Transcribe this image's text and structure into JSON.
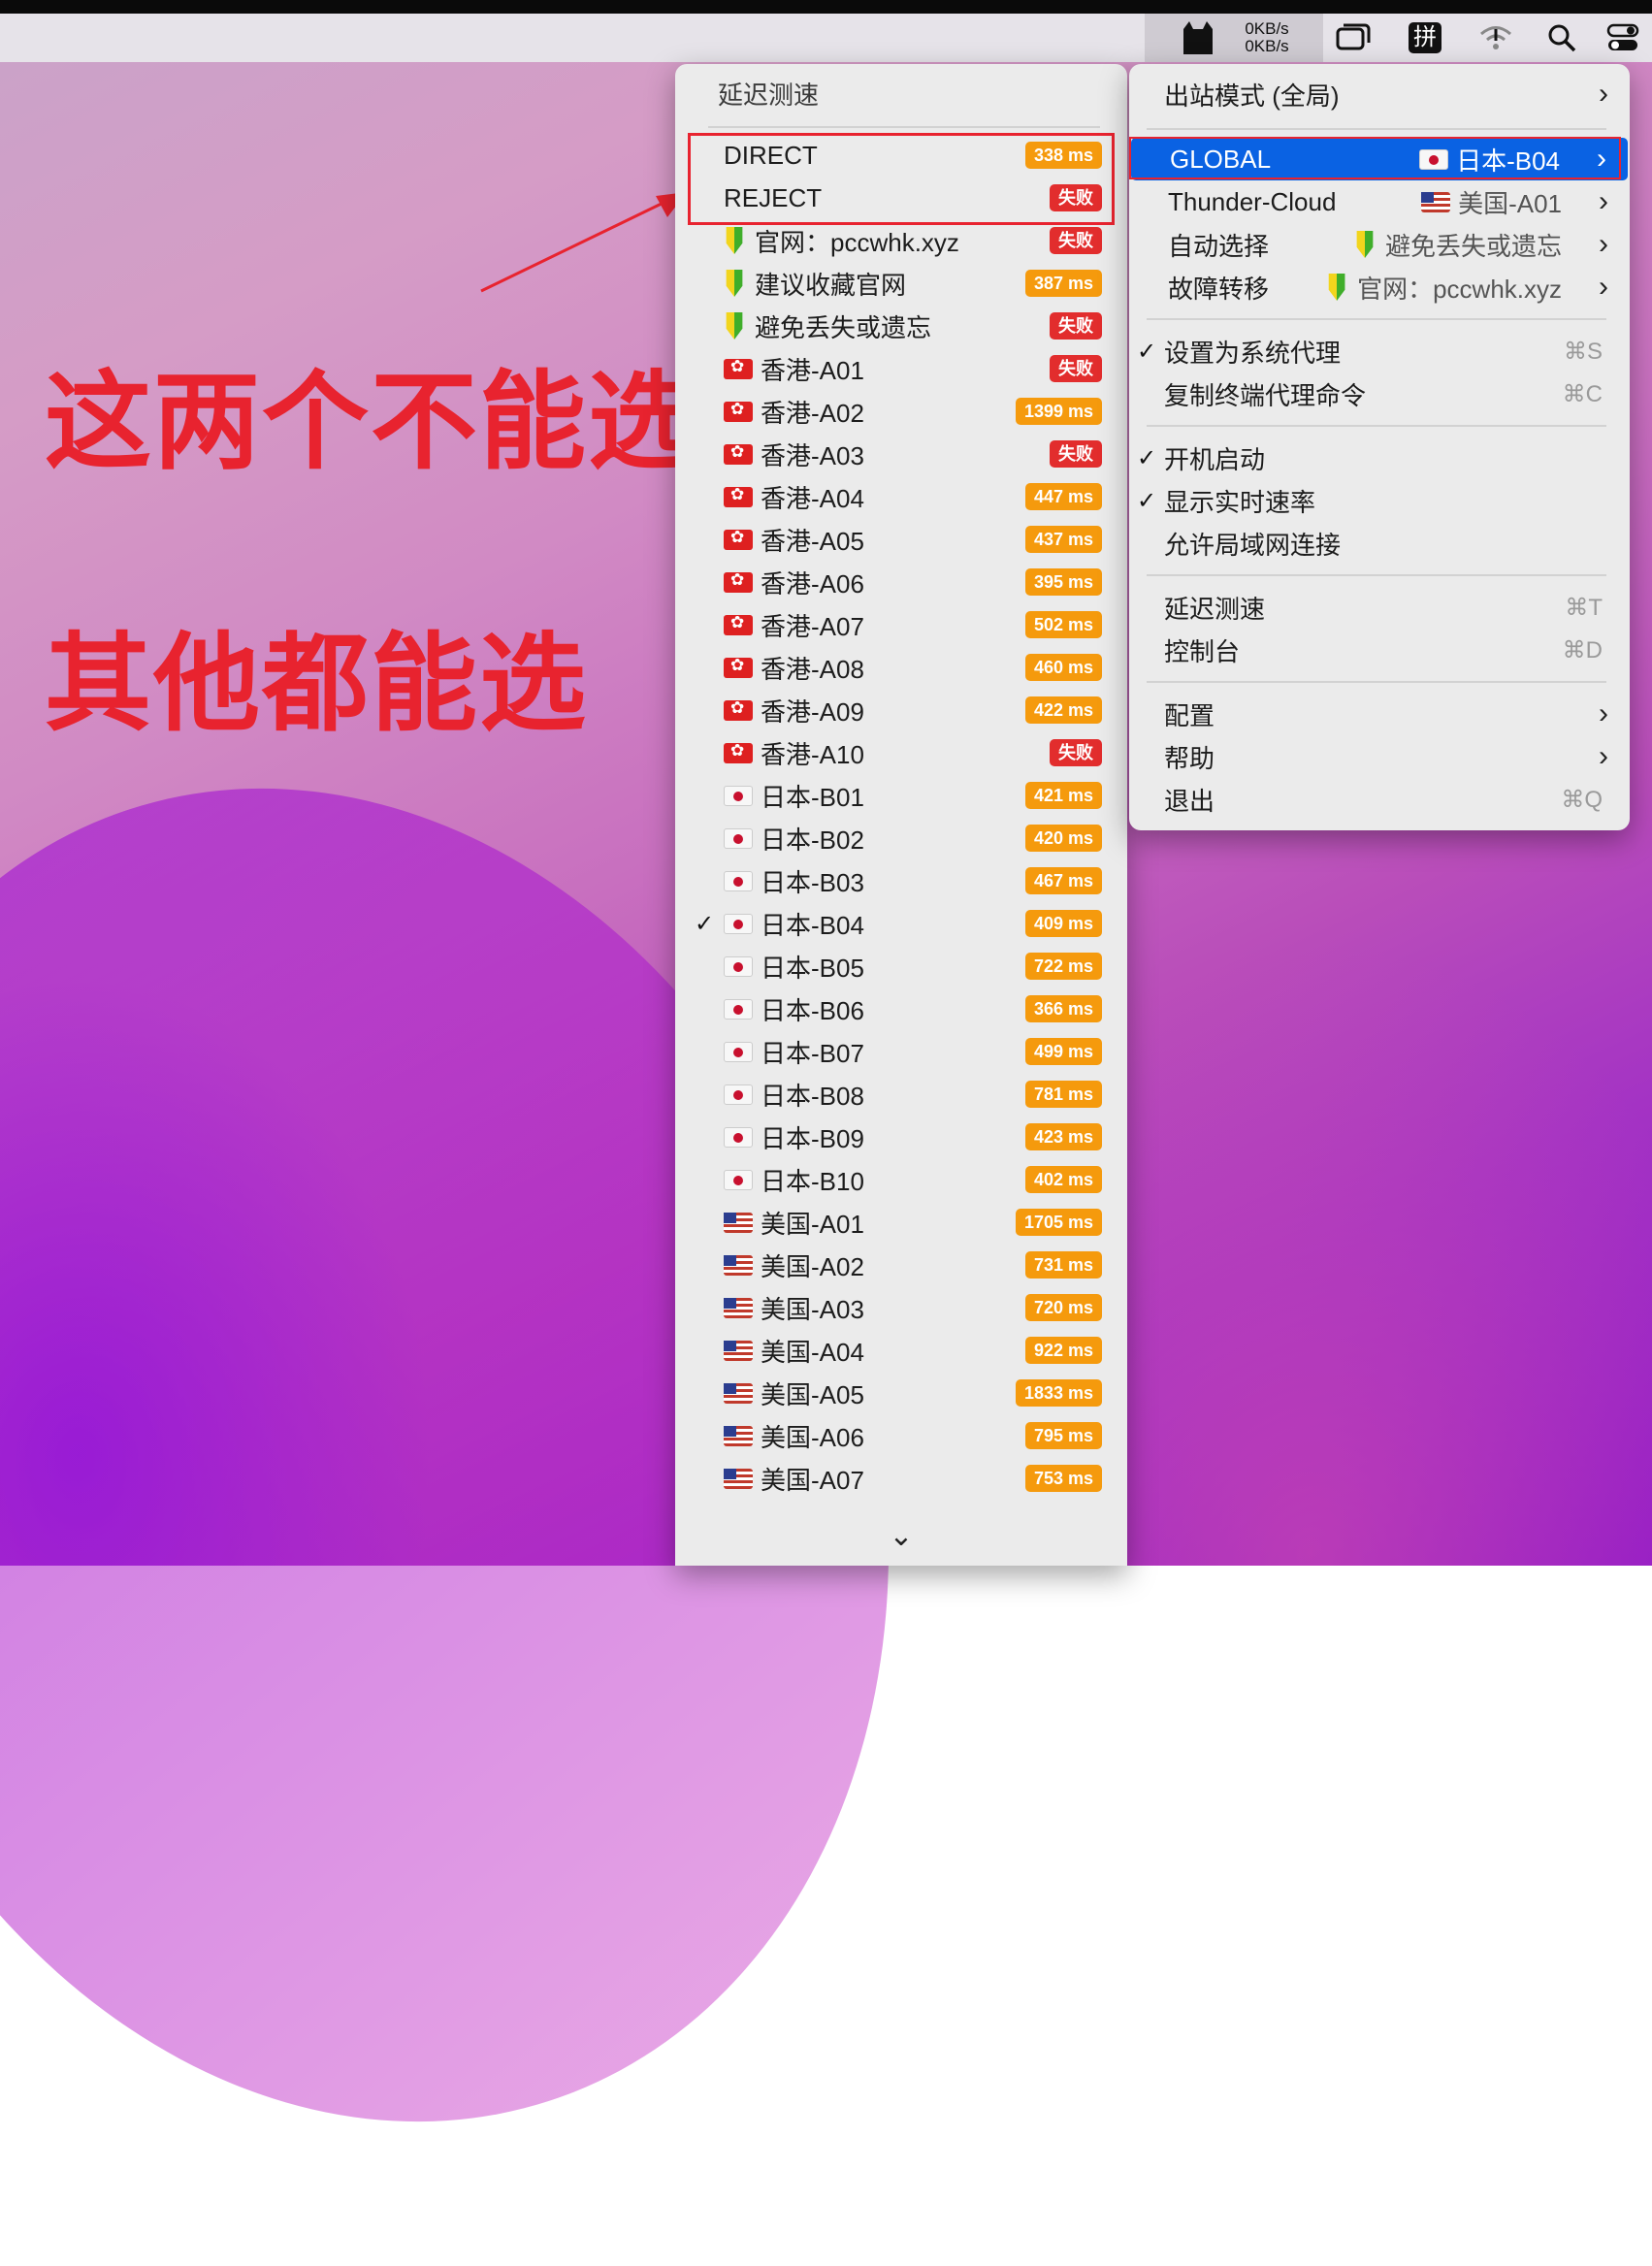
{
  "menubar": {
    "speed_up": "0KB/s",
    "speed_down": "0KB/s",
    "icons": [
      "cat-icon",
      "window-icon",
      "pinyin-icon",
      "wifi-icon",
      "search-icon",
      "control-center-icon"
    ],
    "pinyin_label": "拼"
  },
  "annotation": {
    "line1": "这两个不能选",
    "line2": "其他都能选",
    "color": "#e8232f"
  },
  "proxy_menu": {
    "header": "延迟测速",
    "items": [
      {
        "name": "DIRECT",
        "flag": "",
        "latency": "338 ms",
        "status": "ok"
      },
      {
        "name": "REJECT",
        "flag": "",
        "latency": "失败",
        "status": "fail"
      },
      {
        "name": "官网：pccwhk.xyz",
        "flag": "shield",
        "latency": "失败",
        "status": "fail"
      },
      {
        "name": "建议收藏官网",
        "flag": "shield",
        "latency": "387 ms",
        "status": "ok"
      },
      {
        "name": "避免丢失或遗忘",
        "flag": "shield",
        "latency": "失败",
        "status": "fail"
      },
      {
        "name": "香港-A01",
        "flag": "hk",
        "latency": "失败",
        "status": "fail"
      },
      {
        "name": "香港-A02",
        "flag": "hk",
        "latency": "1399 ms",
        "status": "ok"
      },
      {
        "name": "香港-A03",
        "flag": "hk",
        "latency": "失败",
        "status": "fail"
      },
      {
        "name": "香港-A04",
        "flag": "hk",
        "latency": "447 ms",
        "status": "ok"
      },
      {
        "name": "香港-A05",
        "flag": "hk",
        "latency": "437 ms",
        "status": "ok"
      },
      {
        "name": "香港-A06",
        "flag": "hk",
        "latency": "395 ms",
        "status": "ok"
      },
      {
        "name": "香港-A07",
        "flag": "hk",
        "latency": "502 ms",
        "status": "ok"
      },
      {
        "name": "香港-A08",
        "flag": "hk",
        "latency": "460 ms",
        "status": "ok"
      },
      {
        "name": "香港-A09",
        "flag": "hk",
        "latency": "422 ms",
        "status": "ok"
      },
      {
        "name": "香港-A10",
        "flag": "hk",
        "latency": "失败",
        "status": "fail"
      },
      {
        "name": "日本-B01",
        "flag": "jp",
        "latency": "421 ms",
        "status": "ok"
      },
      {
        "name": "日本-B02",
        "flag": "jp",
        "latency": "420 ms",
        "status": "ok"
      },
      {
        "name": "日本-B03",
        "flag": "jp",
        "latency": "467 ms",
        "status": "ok"
      },
      {
        "name": "日本-B04",
        "flag": "jp",
        "latency": "409 ms",
        "status": "ok",
        "checked": true
      },
      {
        "name": "日本-B05",
        "flag": "jp",
        "latency": "722 ms",
        "status": "ok"
      },
      {
        "name": "日本-B06",
        "flag": "jp",
        "latency": "366 ms",
        "status": "ok"
      },
      {
        "name": "日本-B07",
        "flag": "jp",
        "latency": "499 ms",
        "status": "ok"
      },
      {
        "name": "日本-B08",
        "flag": "jp",
        "latency": "781 ms",
        "status": "ok"
      },
      {
        "name": "日本-B09",
        "flag": "jp",
        "latency": "423 ms",
        "status": "ok"
      },
      {
        "name": "日本-B10",
        "flag": "jp",
        "latency": "402 ms",
        "status": "ok"
      },
      {
        "name": "美国-A01",
        "flag": "us",
        "latency": "1705 ms",
        "status": "ok"
      },
      {
        "name": "美国-A02",
        "flag": "us",
        "latency": "731 ms",
        "status": "ok"
      },
      {
        "name": "美国-A03",
        "flag": "us",
        "latency": "720 ms",
        "status": "ok"
      },
      {
        "name": "美国-A04",
        "flag": "us",
        "latency": "922 ms",
        "status": "ok"
      },
      {
        "name": "美国-A05",
        "flag": "us",
        "latency": "1833 ms",
        "status": "ok"
      },
      {
        "name": "美国-A06",
        "flag": "us",
        "latency": "795 ms",
        "status": "ok"
      },
      {
        "name": "美国-A07",
        "flag": "us",
        "latency": "753 ms",
        "status": "ok"
      }
    ],
    "scroll_indicator": "⌄"
  },
  "main_menu": {
    "outbound_mode": "出站模式 (全局)",
    "groups": [
      {
        "name": "GLOBAL",
        "flag": "jp",
        "value": "日本-B04",
        "selected": true
      },
      {
        "name": "Thunder-Cloud",
        "flag": "us",
        "value": "美国-A01"
      },
      {
        "name": "自动选择",
        "flag": "shield",
        "value": "避免丢失或遗忘"
      },
      {
        "name": "故障转移",
        "flag": "shield",
        "value": "官网：pccwhk.xyz"
      }
    ],
    "set_system_proxy": "设置为系统代理",
    "set_system_proxy_shortcut": "⌘S",
    "copy_terminal_cmd": "复制终端代理命令",
    "copy_terminal_cmd_shortcut": "⌘C",
    "launch_at_login": "开机启动",
    "show_speed": "显示实时速率",
    "allow_lan": "允许局域网连接",
    "latency_test": "延迟测速",
    "latency_test_shortcut": "⌘T",
    "dashboard": "控制台",
    "dashboard_shortcut": "⌘D",
    "config": "配置",
    "help": "帮助",
    "quit": "退出",
    "quit_shortcut": "⌘Q"
  }
}
